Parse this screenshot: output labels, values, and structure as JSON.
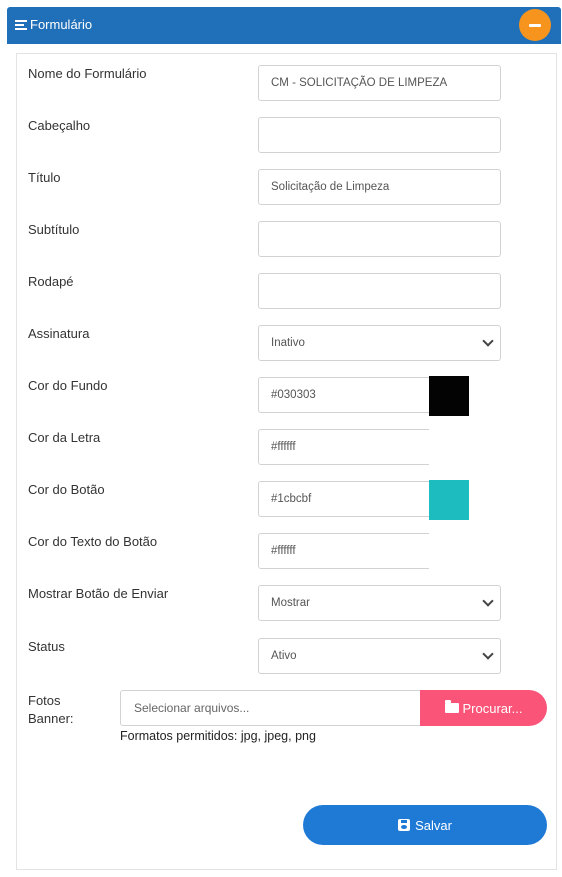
{
  "panel": {
    "title": "Formulário",
    "collapse_icon": "minus-icon"
  },
  "fields": {
    "nome": {
      "label": "Nome do Formulário",
      "value": "CM - SOLICITAÇÃO DE LIMPEZA"
    },
    "cabecalho": {
      "label": "Cabeçalho",
      "value": ""
    },
    "titulo": {
      "label": "Título",
      "value": "Solicitação de Limpeza"
    },
    "subtitulo": {
      "label": "Subtítulo",
      "value": ""
    },
    "rodape": {
      "label": "Rodapé",
      "value": ""
    },
    "assinatura": {
      "label": "Assinatura",
      "value": "Inativo"
    },
    "cor_fundo": {
      "label": "Cor do Fundo",
      "value": "#030303",
      "swatch": "#030303"
    },
    "cor_letra": {
      "label": "Cor da Letra",
      "value": "#ffffff",
      "swatch": "#ffffff"
    },
    "cor_botao": {
      "label": "Cor do Botão",
      "value": "#1cbcbf",
      "swatch": "#1cbcbf"
    },
    "cor_texto_botao": {
      "label": "Cor do Texto do Botão",
      "value": "#ffffff",
      "swatch": "#ffffff"
    },
    "mostrar_botao": {
      "label": "Mostrar Botão de Enviar",
      "value": "Mostrar"
    },
    "status": {
      "label": "Status",
      "value": "Ativo"
    }
  },
  "banner": {
    "label_line1": "Fotos",
    "label_line2": "Banner:",
    "placeholder": "Selecionar arquivos...",
    "browse_label": "Procurar...",
    "browse_icon": "folder-open-icon",
    "formats": "Formatos permitidos: jpg, jpeg, png"
  },
  "actions": {
    "save_label": "Salvar",
    "save_icon": "floppy-disk-icon"
  },
  "colors": {
    "header": "#1f70b8",
    "collapse": "#f7941d",
    "browse": "#fa5478",
    "save": "#1f7ad6"
  }
}
